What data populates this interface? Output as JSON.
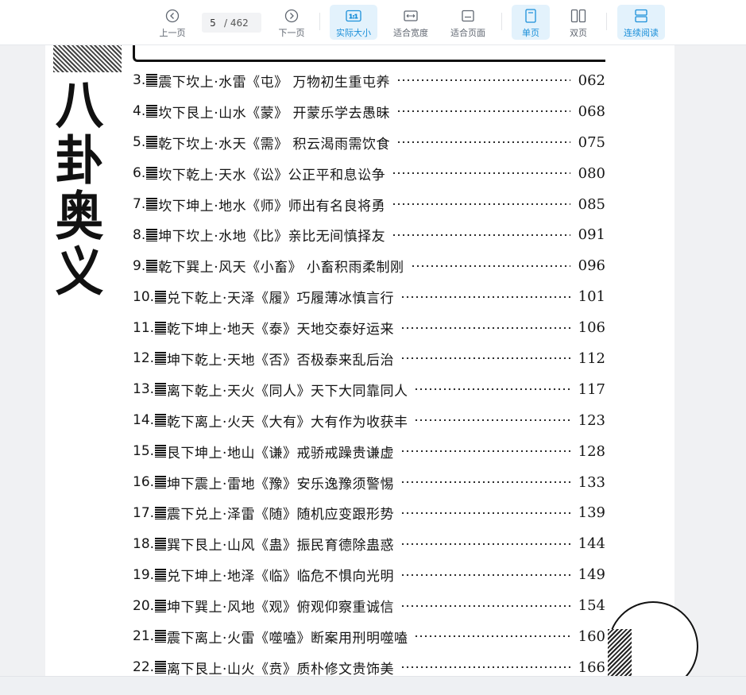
{
  "toolbar": {
    "prev_label": "上一页",
    "current_page": "5",
    "total_pages": "/ 462",
    "next_label": "下一页",
    "actual_size_label": "实际大小",
    "fit_width_label": "适合宽度",
    "fit_page_label": "适合页面",
    "single_page_label": "单页",
    "double_page_label": "双页",
    "continuous_label": "连续阅读",
    "actual_size_icon_text": "1:1",
    "accent_color": "#1a8fd9"
  },
  "document": {
    "side_title": [
      "八",
      "卦",
      "奥",
      "义"
    ],
    "toc": [
      {
        "num": "3.",
        "text": "震下坎上·水雷《屯》 万物初生重屯养",
        "page": "062"
      },
      {
        "num": "4.",
        "text": "坎下艮上·山水《蒙》 开蒙乐学去愚昧",
        "page": "068"
      },
      {
        "num": "5.",
        "text": "乾下坎上·水天《需》 积云渴雨需饮食",
        "page": "075"
      },
      {
        "num": "6.",
        "text": "坎下乾上·天水《讼》公正平和息讼争",
        "page": "080"
      },
      {
        "num": "7.",
        "text": "坎下坤上·地水《师》师出有名良将勇",
        "page": "085"
      },
      {
        "num": "8.",
        "text": "坤下坎上·水地《比》亲比无间慎择友",
        "page": "091"
      },
      {
        "num": "9.",
        "text": "乾下巽上·风天《小畜》 小畜积雨柔制刚",
        "page": "096"
      },
      {
        "num": "10.",
        "text": "兑下乾上·天泽《履》巧履薄冰慎言行",
        "page": "101"
      },
      {
        "num": "11.",
        "text": "乾下坤上·地天《泰》天地交泰好运来",
        "page": "106"
      },
      {
        "num": "12.",
        "text": "坤下乾上·天地《否》否极泰来乱后治",
        "page": "112"
      },
      {
        "num": "13.",
        "text": "离下乾上·天火《同人》天下大同靠同人",
        "page": "117"
      },
      {
        "num": "14.",
        "text": "乾下离上·火天《大有》大有作为收获丰",
        "page": "123"
      },
      {
        "num": "15.",
        "text": "艮下坤上·地山《谦》戒骄戒躁贵谦虚",
        "page": "128"
      },
      {
        "num": "16.",
        "text": "坤下震上·雷地《豫》安乐逸豫须警惕",
        "page": "133"
      },
      {
        "num": "17.",
        "text": "震下兑上·泽雷《随》随机应变跟形势",
        "page": "139"
      },
      {
        "num": "18.",
        "text": "巽下艮上·山风《蛊》振民育德除蛊惑",
        "page": "144"
      },
      {
        "num": "19.",
        "text": "兑下坤上·地泽《临》临危不惧向光明",
        "page": "149"
      },
      {
        "num": "20.",
        "text": "坤下巽上·风地《观》俯观仰察重诚信",
        "page": "154"
      },
      {
        "num": "21.",
        "text": "震下离上·火雷《噬嗑》断案用刑明噬嗑",
        "page": "160"
      },
      {
        "num": "22.",
        "text": "离下艮上·山火《贲》质朴修文贵饰美",
        "page": "166"
      }
    ]
  }
}
